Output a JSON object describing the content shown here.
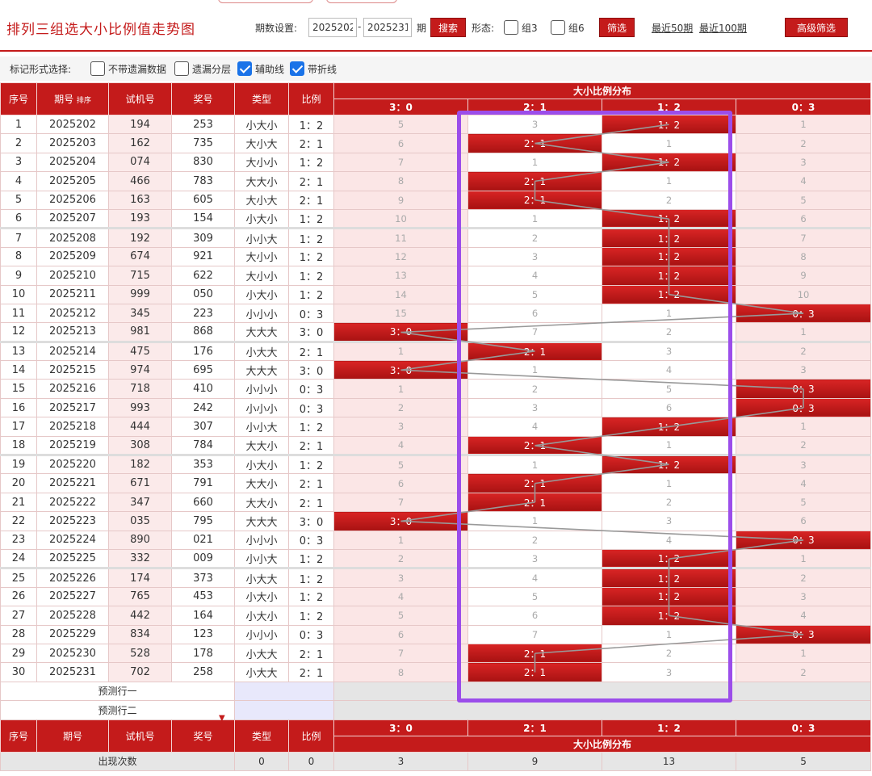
{
  "header": {
    "title": "排列三组选大小比例值走势图",
    "period_label": "期数设置:",
    "period_from": "2025202",
    "period_to": "2025231",
    "period_suffix": "期",
    "dash": "-",
    "search_label": "搜索",
    "form_label": "形态:",
    "group3_label": "组3",
    "group6_label": "组6",
    "filter_label": "筛选",
    "last50_label": "最近50期",
    "last100_label": "最近100期",
    "advanced_label": "高级筛选"
  },
  "mark_bar": {
    "label": "标记形式选择:",
    "options": [
      {
        "label": "不带遗漏数据",
        "checked": false
      },
      {
        "label": "遗漏分层",
        "checked": false
      },
      {
        "label": "辅助线",
        "checked": true
      },
      {
        "label": "带折线",
        "checked": true
      }
    ]
  },
  "table": {
    "headers": {
      "idx": "序号",
      "period": "期号",
      "sort": "排序",
      "test": "试机号",
      "win": "奖号",
      "type": "类型",
      "ratio": "比例",
      "dist": "大小比例分布"
    },
    "dist_cols": [
      "3：0",
      "2：1",
      "1：2",
      "0：3"
    ],
    "rows": [
      {
        "idx": "1",
        "period": "2025202",
        "test": "194",
        "win": "253",
        "type": "小大小",
        "ratio": "1：2",
        "dist": [
          "5",
          "3",
          "1：2",
          "1"
        ]
      },
      {
        "idx": "2",
        "period": "2025203",
        "test": "162",
        "win": "735",
        "type": "大小大",
        "ratio": "2：1",
        "dist": [
          "6",
          "2：1",
          "1",
          "2"
        ]
      },
      {
        "idx": "3",
        "period": "2025204",
        "test": "074",
        "win": "830",
        "type": "大小小",
        "ratio": "1：2",
        "dist": [
          "7",
          "1",
          "1：2",
          "3"
        ]
      },
      {
        "idx": "4",
        "period": "2025205",
        "test": "466",
        "win": "783",
        "type": "大大小",
        "ratio": "2：1",
        "dist": [
          "8",
          "2：1",
          "1",
          "4"
        ]
      },
      {
        "idx": "5",
        "period": "2025206",
        "test": "163",
        "win": "605",
        "type": "大小大",
        "ratio": "2：1",
        "dist": [
          "9",
          "2：1",
          "2",
          "5"
        ]
      },
      {
        "idx": "6",
        "period": "2025207",
        "test": "193",
        "win": "154",
        "type": "小大小",
        "ratio": "1：2",
        "dist": [
          "10",
          "1",
          "1：2",
          "6"
        ]
      },
      {
        "idx": "7",
        "period": "2025208",
        "test": "192",
        "win": "309",
        "type": "小小大",
        "ratio": "1：2",
        "dist": [
          "11",
          "2",
          "1：2",
          "7"
        ]
      },
      {
        "idx": "8",
        "period": "2025209",
        "test": "674",
        "win": "921",
        "type": "大小小",
        "ratio": "1：2",
        "dist": [
          "12",
          "3",
          "1：2",
          "8"
        ]
      },
      {
        "idx": "9",
        "period": "2025210",
        "test": "715",
        "win": "622",
        "type": "大小小",
        "ratio": "1：2",
        "dist": [
          "13",
          "4",
          "1：2",
          "9"
        ]
      },
      {
        "idx": "10",
        "period": "2025211",
        "test": "999",
        "win": "050",
        "type": "小大小",
        "ratio": "1：2",
        "dist": [
          "14",
          "5",
          "1：2",
          "10"
        ]
      },
      {
        "idx": "11",
        "period": "2025212",
        "test": "345",
        "win": "223",
        "type": "小小小",
        "ratio": "0：3",
        "dist": [
          "15",
          "6",
          "1",
          "0：3"
        ]
      },
      {
        "idx": "12",
        "period": "2025213",
        "test": "981",
        "win": "868",
        "type": "大大大",
        "ratio": "3：0",
        "dist": [
          "3：0",
          "7",
          "2",
          "1"
        ]
      },
      {
        "idx": "13",
        "period": "2025214",
        "test": "475",
        "win": "176",
        "type": "小大大",
        "ratio": "2：1",
        "dist": [
          "1",
          "2：1",
          "3",
          "2"
        ]
      },
      {
        "idx": "14",
        "period": "2025215",
        "test": "974",
        "win": "695",
        "type": "大大大",
        "ratio": "3：0",
        "dist": [
          "3：0",
          "1",
          "4",
          "3"
        ]
      },
      {
        "idx": "15",
        "period": "2025216",
        "test": "718",
        "win": "410",
        "type": "小小小",
        "ratio": "0：3",
        "dist": [
          "1",
          "2",
          "5",
          "0：3"
        ]
      },
      {
        "idx": "16",
        "period": "2025217",
        "test": "993",
        "win": "242",
        "type": "小小小",
        "ratio": "0：3",
        "dist": [
          "2",
          "3",
          "6",
          "0：3"
        ]
      },
      {
        "idx": "17",
        "period": "2025218",
        "test": "444",
        "win": "307",
        "type": "小小大",
        "ratio": "1：2",
        "dist": [
          "3",
          "4",
          "1：2",
          "1"
        ]
      },
      {
        "idx": "18",
        "period": "2025219",
        "test": "308",
        "win": "784",
        "type": "大大小",
        "ratio": "2：1",
        "dist": [
          "4",
          "2：1",
          "1",
          "2"
        ]
      },
      {
        "idx": "19",
        "period": "2025220",
        "test": "182",
        "win": "353",
        "type": "小大小",
        "ratio": "1：2",
        "dist": [
          "5",
          "1",
          "1：2",
          "3"
        ]
      },
      {
        "idx": "20",
        "period": "2025221",
        "test": "671",
        "win": "791",
        "type": "大大小",
        "ratio": "2：1",
        "dist": [
          "6",
          "2：1",
          "1",
          "4"
        ]
      },
      {
        "idx": "21",
        "period": "2025222",
        "test": "347",
        "win": "660",
        "type": "大大小",
        "ratio": "2：1",
        "dist": [
          "7",
          "2：1",
          "2",
          "5"
        ]
      },
      {
        "idx": "22",
        "period": "2025223",
        "test": "035",
        "win": "795",
        "type": "大大大",
        "ratio": "3：0",
        "dist": [
          "3：0",
          "1",
          "3",
          "6"
        ]
      },
      {
        "idx": "23",
        "period": "2025224",
        "test": "890",
        "win": "021",
        "type": "小小小",
        "ratio": "0：3",
        "dist": [
          "1",
          "2",
          "4",
          "0：3"
        ]
      },
      {
        "idx": "24",
        "period": "2025225",
        "test": "332",
        "win": "009",
        "type": "小小大",
        "ratio": "1：2",
        "dist": [
          "2",
          "3",
          "1：2",
          "1"
        ]
      },
      {
        "idx": "25",
        "period": "2025226",
        "test": "174",
        "win": "373",
        "type": "小大大",
        "ratio": "1：2",
        "dist": [
          "3",
          "4",
          "1：2",
          "2"
        ]
      },
      {
        "idx": "26",
        "period": "2025227",
        "test": "765",
        "win": "453",
        "type": "小大小",
        "ratio": "1：2",
        "dist": [
          "4",
          "5",
          "1：2",
          "3"
        ]
      },
      {
        "idx": "27",
        "period": "2025228",
        "test": "442",
        "win": "164",
        "type": "小大小",
        "ratio": "1：2",
        "dist": [
          "5",
          "6",
          "1：2",
          "4"
        ]
      },
      {
        "idx": "28",
        "period": "2025229",
        "test": "834",
        "win": "123",
        "type": "小小小",
        "ratio": "0：3",
        "dist": [
          "6",
          "7",
          "1",
          "0：3"
        ]
      },
      {
        "idx": "29",
        "period": "2025230",
        "test": "528",
        "win": "178",
        "type": "小大大",
        "ratio": "2：1",
        "dist": [
          "7",
          "2：1",
          "2",
          "1"
        ]
      },
      {
        "idx": "30",
        "period": "2025231",
        "test": "702",
        "win": "258",
        "type": "小大大",
        "ratio": "2：1",
        "dist": [
          "8",
          "2：1",
          "3",
          "2"
        ]
      }
    ],
    "hit_cols": [
      2,
      1,
      2,
      1,
      1,
      2,
      2,
      2,
      2,
      2,
      3,
      0,
      1,
      0,
      3,
      3,
      2,
      1,
      2,
      1,
      1,
      0,
      3,
      2,
      2,
      2,
      2,
      3,
      1,
      1
    ],
    "pred1": "预测行一",
    "pred2": "预测行二",
    "footer": {
      "label": "出现次数",
      "type": "0",
      "ratio": "0",
      "counts": [
        "3",
        "9",
        "13",
        "5"
      ]
    }
  },
  "colors": {
    "accent": "#c41b1b",
    "highlight": "#9b4dea",
    "checkbox": "#1a73e8"
  }
}
